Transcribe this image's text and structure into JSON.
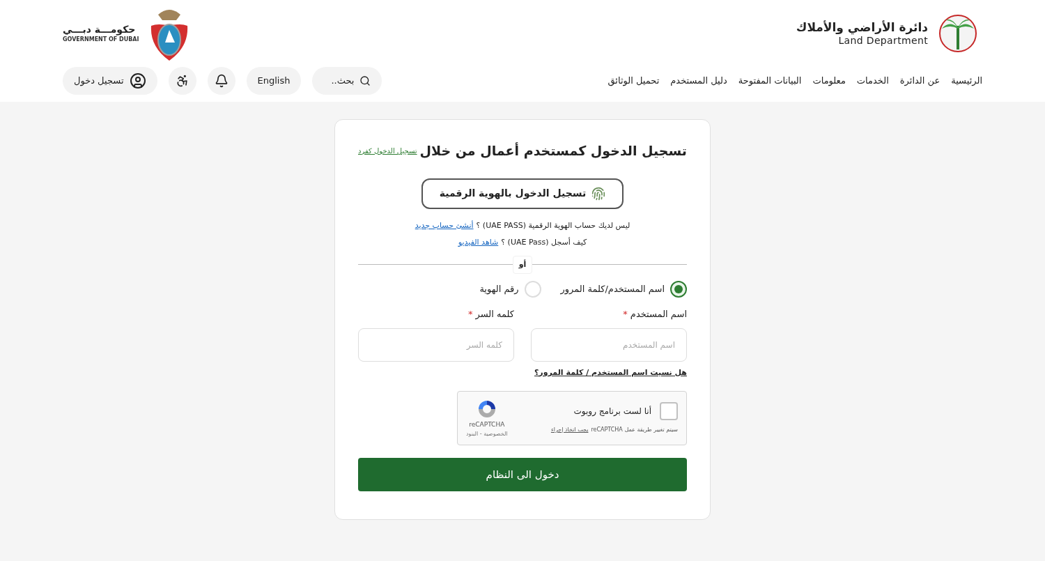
{
  "header": {
    "land_logo": {
      "arabic": "دائرة الأراضي والأملاك",
      "english": "Land Department"
    },
    "gov_logo": {
      "arabic": "حكومـــة دبـــي",
      "english": "GOVERNMENT OF DUBAI"
    },
    "nav": [
      {
        "label": "الرئيسية"
      },
      {
        "label": "عن الدائرة"
      },
      {
        "label": "الخدمات"
      },
      {
        "label": "معلومات"
      },
      {
        "label": "البيانات المفتوحة"
      },
      {
        "label": "دليل المستخدم"
      },
      {
        "label": "تحميل الوثائق"
      }
    ],
    "tools": [
      {
        "kind": "search",
        "label": "بحث.."
      },
      {
        "kind": "language",
        "label": "English"
      },
      {
        "kind": "notifications"
      },
      {
        "kind": "accessibility"
      },
      {
        "kind": "login",
        "label": "تسجيل دخول"
      }
    ]
  },
  "login": {
    "title": "تسجيل الدخول كمستخدم أعمال من خلال",
    "individual_link": "تسجيل الدخول كفرد",
    "uaepass_button": "تسجيل الدخول بالهوية الرقمية",
    "help_lines": [
      {
        "text": "ليس لديك حساب الهوية الرقمية (UAE PASS) ؟",
        "link": "أنشئ حساب جديد"
      },
      {
        "text": "كيف أسجل (UAE Pass) ؟",
        "link": "شاهد الفيديو"
      }
    ],
    "divider": "أو",
    "methods": [
      {
        "label": "اسم المستخدم/كلمة المرور",
        "selected": true
      },
      {
        "label": "رقم الهوية",
        "selected": false
      }
    ],
    "fields": [
      {
        "label": "اسم المستخدم",
        "required_mark": "*",
        "placeholder": "اسم المستخدم"
      },
      {
        "label": "كلمه السر",
        "required_mark": "*",
        "placeholder": "كلمه السر"
      }
    ],
    "forgot_link": "هل نسيت اسم المستخدم / كلمة المرور؟",
    "captcha": {
      "checked": false,
      "label": "أنا لست برنامج روبوت",
      "notice": "سيتم تغيير طريقة عمل reCAPTCHA",
      "notice_link": "يجب اتخاذ إجراء",
      "brand": "reCAPTCHA",
      "terms": "الخصوصية - البنود"
    },
    "submit": "دخول الى النظام"
  }
}
